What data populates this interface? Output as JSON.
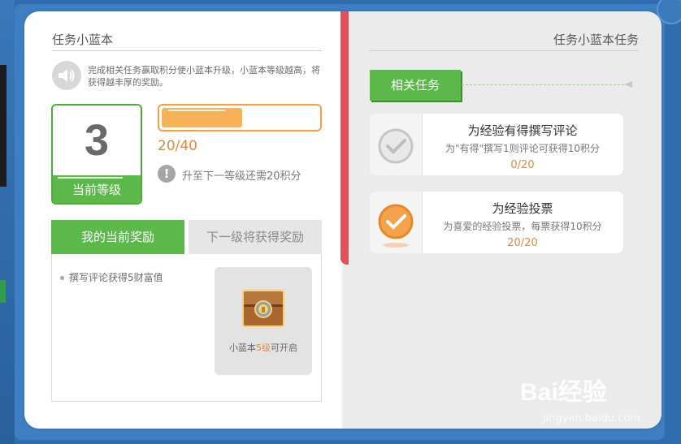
{
  "left_page": {
    "title": "任务小蓝本",
    "notice": "完成相关任务赢取积分使小蓝本升级，小蓝本等级越高，将获得越丰厚的奖励。",
    "level": {
      "number": "3",
      "label": "当前等级"
    },
    "progress": {
      "fraction": 0.5,
      "text": "20/40",
      "hint": "升至下一等级还需20积分"
    },
    "tabs": {
      "current": "我的当前奖励",
      "next": "下一级将获得奖励"
    },
    "rewards": [
      {
        "text": "撰写评论获得5财富值"
      }
    ],
    "chest": {
      "caption_prefix": "小蓝本",
      "caption_highlight": "5级",
      "caption_suffix": "可开启"
    }
  },
  "right_page": {
    "title": "任务小蓝本任务",
    "section_label": "相关任务",
    "tasks": [
      {
        "title": "为经验有得撰写评论",
        "description": "为\"有得\"撰写1则评论可获得10积分",
        "progress": "0/20",
        "status_icon": "check-circle-gray-icon"
      },
      {
        "title": "为经验投票",
        "description": "为喜爱的经验投票，每票获得10积分",
        "progress": "20/20",
        "status_icon": "check-circle-orange-icon"
      }
    ]
  },
  "watermark": {
    "brand": "Bai经验",
    "url": "jingyan.baidu.com"
  },
  "colors": {
    "accent_green": "#5ab949",
    "accent_orange": "#f2a04a",
    "spine_red": "#e0525b",
    "frame_blue": "#3d7fc2"
  }
}
